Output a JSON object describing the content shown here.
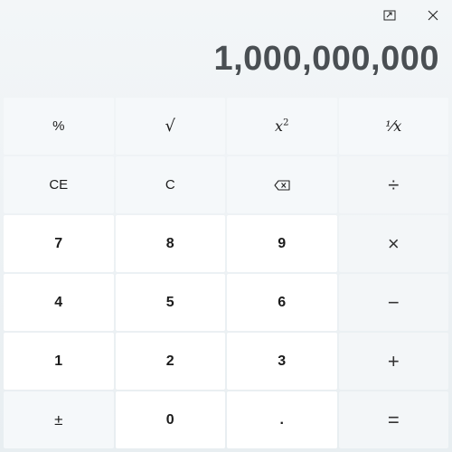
{
  "display": {
    "value": "1,000,000,000"
  },
  "keys": {
    "percent": "%",
    "sqrt": "√",
    "square_base": "x",
    "square_exp": "2",
    "reciprocal": "⅟x",
    "ce": "CE",
    "c": "C",
    "divide": "÷",
    "seven": "7",
    "eight": "8",
    "nine": "9",
    "multiply": "×",
    "four": "4",
    "five": "5",
    "six": "6",
    "minus": "−",
    "one": "1",
    "two": "2",
    "three": "3",
    "plus": "+",
    "negate": "±",
    "zero": "0",
    "decimal": ".",
    "equals": "="
  },
  "icons": {
    "overlay": "keep-on-top-icon",
    "close": "close-icon",
    "backspace": "backspace-icon"
  }
}
